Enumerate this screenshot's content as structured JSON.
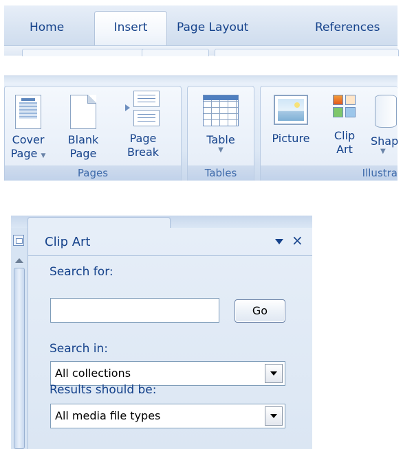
{
  "tabs": {
    "home": "Home",
    "insert": "Insert",
    "page_layout": "Page Layout",
    "references": "References"
  },
  "ribbon": {
    "pages_group": {
      "label": "Pages",
      "cover_page": [
        "Cover",
        "Page"
      ],
      "blank_page": [
        "Blank",
        "Page"
      ],
      "page_break": [
        "Page",
        "Break"
      ]
    },
    "tables_group": {
      "label": "Tables",
      "table": "Table"
    },
    "illustrations_group": {
      "label": "Illustra",
      "picture": "Picture",
      "clip_art": [
        "Clip",
        "Art"
      ],
      "shapes": "Shap"
    }
  },
  "clip_art_pane": {
    "title": "Clip Art",
    "close": "×",
    "search_for_label": "Search for:",
    "search_value": "",
    "go_label": "Go",
    "search_in_label": "Search in:",
    "search_in_value": "All collections",
    "results_label": "Results should be:",
    "results_value": "All media file types"
  },
  "colors": {
    "ribbon_text": "#15428b",
    "group_label": "#3e6aaa",
    "ribbon_bg": "#dde8f5"
  }
}
